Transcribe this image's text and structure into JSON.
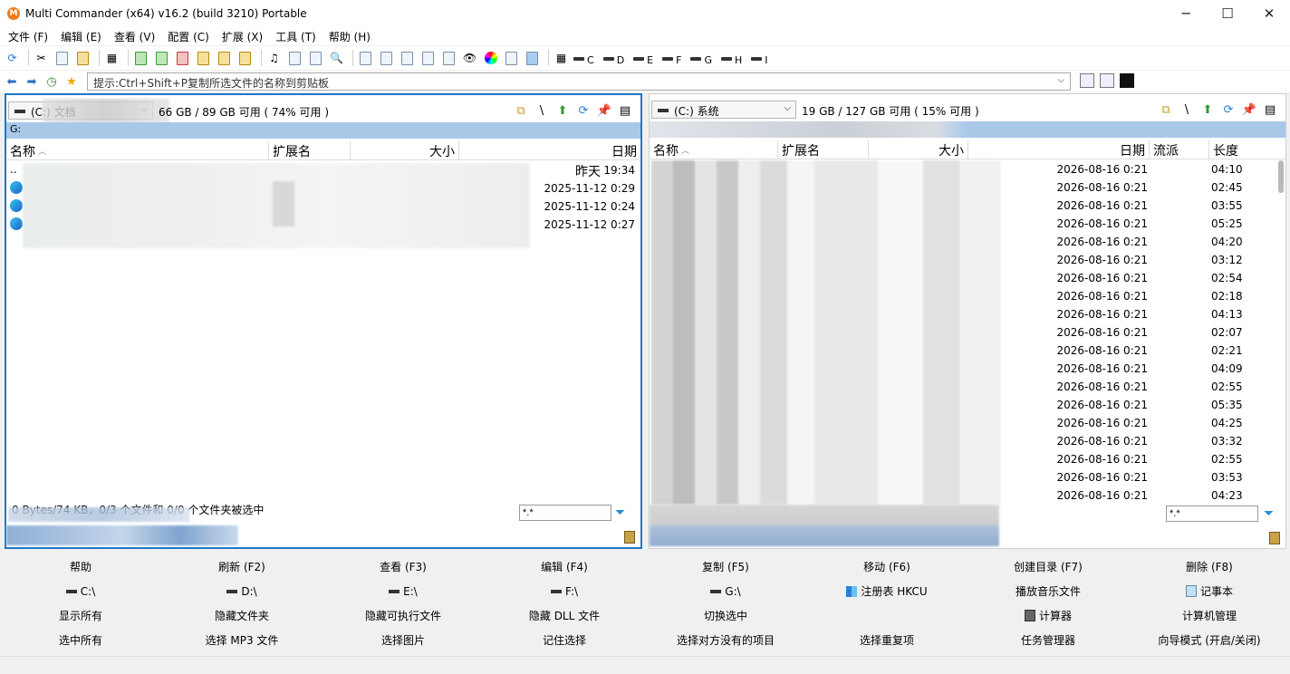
{
  "window": {
    "title": "Multi Commander (x64)  v16.2 (build 3210) Portable",
    "buttons": {
      "minimize": "─",
      "maximize": "☐",
      "close": "✕"
    }
  },
  "menu": [
    "文件 (F)",
    "编辑 (E)",
    "查看 (V)",
    "配置 (C)",
    "扩展 (X)",
    "工具 (T)",
    "帮助 (H)"
  ],
  "toolbar": {
    "drives": [
      "C",
      "D",
      "E",
      "F",
      "G",
      "H",
      "I"
    ]
  },
  "address": {
    "placeholder": "提示:Ctrl+Shift+P复制所选文件的名称到剪贴板"
  },
  "left_panel": {
    "drive": "(C:) 文档",
    "free": "66 GB / 89 GB 可用 ( 74% 可用 )",
    "path": "G:",
    "columns": {
      "name": "名称",
      "ext": "扩展名",
      "size": "大小",
      "date": "日期"
    },
    "rows": [
      {
        "name": "..",
        "date_day": "昨天",
        "date_time": "19:34"
      },
      {
        "name": "",
        "date": "2025-11-12 0:29"
      },
      {
        "name": "",
        "date": "2025-11-12 0:24"
      },
      {
        "name": "",
        "date": "2025-11-12 0:27"
      }
    ],
    "status": "0 Bytes/74 KB，0/3 个文件和 0/0 个文件夹被选中",
    "filter": "*.*"
  },
  "right_panel": {
    "drive": "(C:) 系统",
    "free": "19 GB / 127 GB 可用 ( 15% 可用 )",
    "columns": {
      "name": "名称",
      "ext": "扩展名",
      "size": "大小",
      "date": "日期",
      "genre": "流派",
      "length": "长度"
    },
    "rows": [
      {
        "date": "2026-08-16 0:21",
        "length": "04:10"
      },
      {
        "date": "2026-08-16 0:21",
        "length": "02:45"
      },
      {
        "date": "2026-08-16 0:21",
        "length": "03:55"
      },
      {
        "date": "2026-08-16 0:21",
        "length": "05:25"
      },
      {
        "date": "2026-08-16 0:21",
        "length": "04:20"
      },
      {
        "date": "2026-08-16 0:21",
        "length": "03:12"
      },
      {
        "date": "2026-08-16 0:21",
        "length": "02:54"
      },
      {
        "date": "2026-08-16 0:21",
        "length": "02:18"
      },
      {
        "date": "2026-08-16 0:21",
        "length": "04:13"
      },
      {
        "date": "2026-08-16 0:21",
        "length": "02:07"
      },
      {
        "date": "2026-08-16 0:21",
        "length": "02:21"
      },
      {
        "date": "2026-08-16 0:21",
        "length": "04:09"
      },
      {
        "date": "2026-08-16 0:21",
        "length": "02:55"
      },
      {
        "date": "2026-08-16 0:21",
        "length": "05:35"
      },
      {
        "date": "2026-08-16 0:21",
        "length": "04:25"
      },
      {
        "date": "2026-08-16 0:21",
        "length": "03:32"
      },
      {
        "date": "2026-08-16 0:21",
        "length": "02:55"
      },
      {
        "date": "2026-08-16 0:21",
        "length": "03:53"
      },
      {
        "date": "2026-08-16 0:21",
        "length": "04:23"
      }
    ],
    "filter": "*.*"
  },
  "function_bar": [
    [
      "帮助",
      "刷新 (F2)",
      "查看 (F3)",
      "编辑 (F4)",
      "复制 (F5)",
      "移动 (F6)",
      "创建目录 (F7)",
      "删除 (F8)"
    ],
    [
      "C:\\",
      "D:\\",
      "E:\\",
      "F:\\",
      "G:\\",
      "注册表 HKCU",
      "播放音乐文件",
      "记事本"
    ],
    [
      "显示所有",
      "隐藏文件夹",
      "隐藏可执行文件",
      "隐藏 DLL 文件",
      "切换选中",
      "",
      "",
      "计算器",
      "计算机管理"
    ],
    [
      "选中所有",
      "选择 MP3 文件",
      "选择图片",
      "记住选择",
      "选择对方没有的项目",
      "选择重复项",
      "任务管理器",
      "向导模式 (开启/关闭)"
    ]
  ],
  "function_bar_rows": {
    "row1": [
      "帮助",
      "刷新 (F2)",
      "查看 (F3)",
      "编辑 (F4)",
      "复制 (F5)",
      "移动 (F6)",
      "创建目录 (F7)",
      "删除 (F8)"
    ],
    "row2": [
      "C:\\",
      "D:\\",
      "E:\\",
      "F:\\",
      "G:\\",
      "注册表 HKCU",
      "播放音乐文件",
      "记事本"
    ],
    "row3": [
      "显示所有",
      "隐藏文件夹",
      "隐藏可执行文件",
      "隐藏 DLL 文件",
      "切换选中",
      "",
      "计算器",
      "计算机管理"
    ],
    "row4": [
      "选中所有",
      "选择 MP3 文件",
      "选择图片",
      "记住选择",
      "选择对方没有的项目",
      "选择重复项",
      "任务管理器",
      "向导模式 (开启/关闭)"
    ]
  }
}
